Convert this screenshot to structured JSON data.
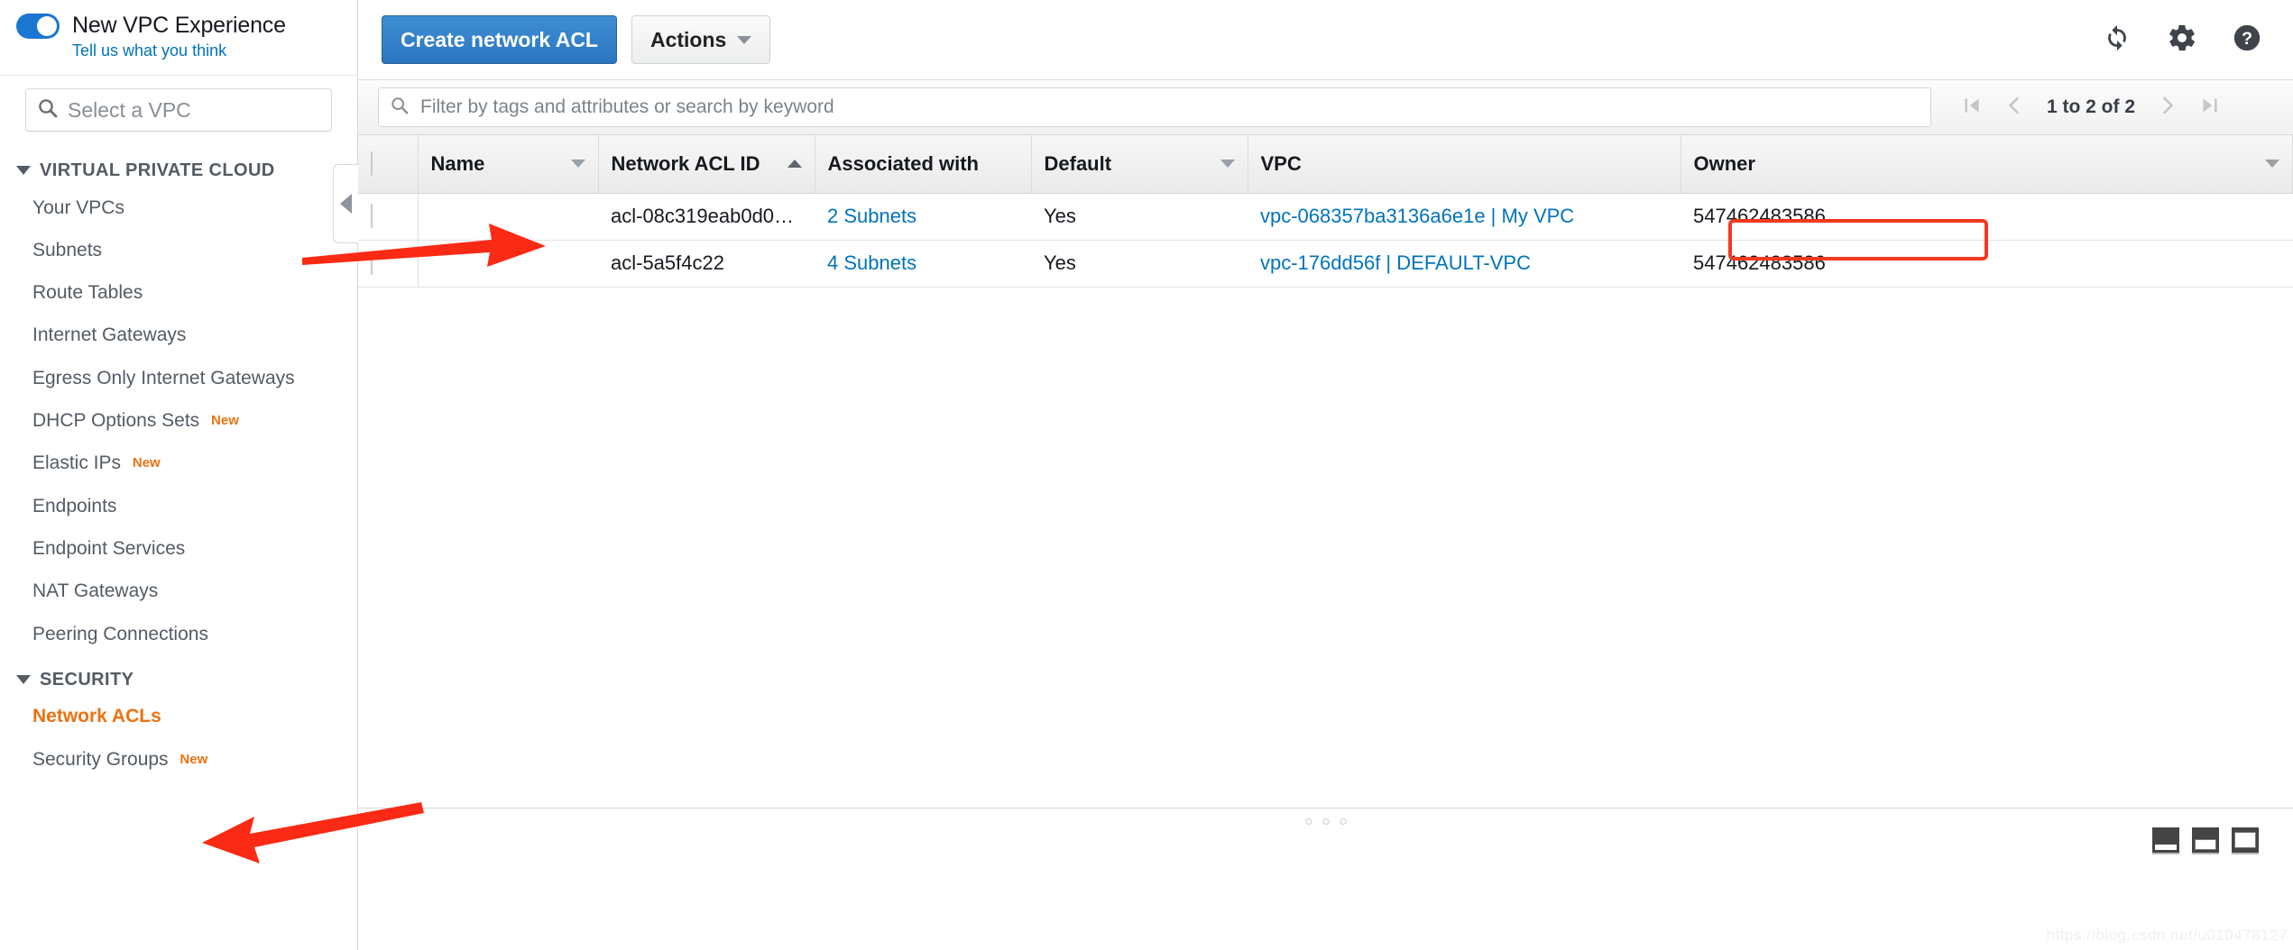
{
  "sidebar": {
    "experience": {
      "title": "New VPC Experience",
      "feedback_link": "Tell us what you think",
      "toggle_on": true,
      "accent": "#1b76d2"
    },
    "vpc_select_placeholder": "Select a VPC",
    "groups": [
      {
        "label": "VIRTUAL PRIVATE CLOUD",
        "expanded": true,
        "items": [
          {
            "label": "Your VPCs",
            "badge": "",
            "selected": false
          },
          {
            "label": "Subnets",
            "badge": "",
            "selected": false
          },
          {
            "label": "Route Tables",
            "badge": "",
            "selected": false
          },
          {
            "label": "Internet Gateways",
            "badge": "",
            "selected": false
          },
          {
            "label": "Egress Only Internet Gateways",
            "badge": "",
            "selected": false
          },
          {
            "label": "DHCP Options Sets",
            "badge": "New",
            "selected": false
          },
          {
            "label": "Elastic IPs",
            "badge": "New",
            "selected": false
          },
          {
            "label": "Endpoints",
            "badge": "",
            "selected": false
          },
          {
            "label": "Endpoint Services",
            "badge": "",
            "selected": false
          },
          {
            "label": "NAT Gateways",
            "badge": "",
            "selected": false
          },
          {
            "label": "Peering Connections",
            "badge": "",
            "selected": false
          }
        ]
      },
      {
        "label": "SECURITY",
        "expanded": true,
        "items": [
          {
            "label": "Network ACLs",
            "badge": "",
            "selected": true
          },
          {
            "label": "Security Groups",
            "badge": "New",
            "selected": false
          }
        ]
      }
    ],
    "selected_color": "#ec7211"
  },
  "toolbar": {
    "create_label": "Create network ACL",
    "actions_label": "Actions",
    "icons": [
      "refresh-icon",
      "gear-icon",
      "help-icon"
    ]
  },
  "filterbar": {
    "search_placeholder": "Filter by tags and attributes or search by keyword",
    "search_value": "",
    "pagination_text": "1 to 2 of 2"
  },
  "table": {
    "columns": [
      {
        "label": "Name",
        "sort": "down"
      },
      {
        "label": "Network ACL ID",
        "sort": "up"
      },
      {
        "label": "Associated with",
        "sort": "none"
      },
      {
        "label": "Default",
        "sort": "down"
      },
      {
        "label": "VPC",
        "sort": "none"
      },
      {
        "label": "Owner",
        "sort": "down"
      }
    ],
    "rows": [
      {
        "name": "",
        "acl_id": "acl-08c319eab0d0…",
        "associated_with": "2 Subnets",
        "default": "Yes",
        "vpc": "vpc-068357ba3136a6e1e | My VPC",
        "owner": "547462483586",
        "vpc_highlighted": true
      },
      {
        "name": "",
        "acl_id": "acl-5a5f4c22",
        "associated_with": "4 Subnets",
        "default": "Yes",
        "vpc": "vpc-176dd56f | DEFAULT-VPC",
        "owner": "547462483586",
        "vpc_highlighted": false
      }
    ]
  },
  "annotations": {
    "highlight_color": "#f4391e",
    "arrow_color": "#fb2a14",
    "arrows": [
      {
        "name": "arrow-to-acl-row",
        "points_to": "first table row"
      },
      {
        "name": "arrow-to-network-acls",
        "points_to": "Network ACLs sidebar item"
      }
    ]
  },
  "footer": {
    "panel_layout_icons": [
      "panel-bottom-small-icon",
      "panel-bottom-medium-icon",
      "panel-bottom-large-icon"
    ],
    "watermark": "https://blog.csdn.net/u010478127"
  }
}
